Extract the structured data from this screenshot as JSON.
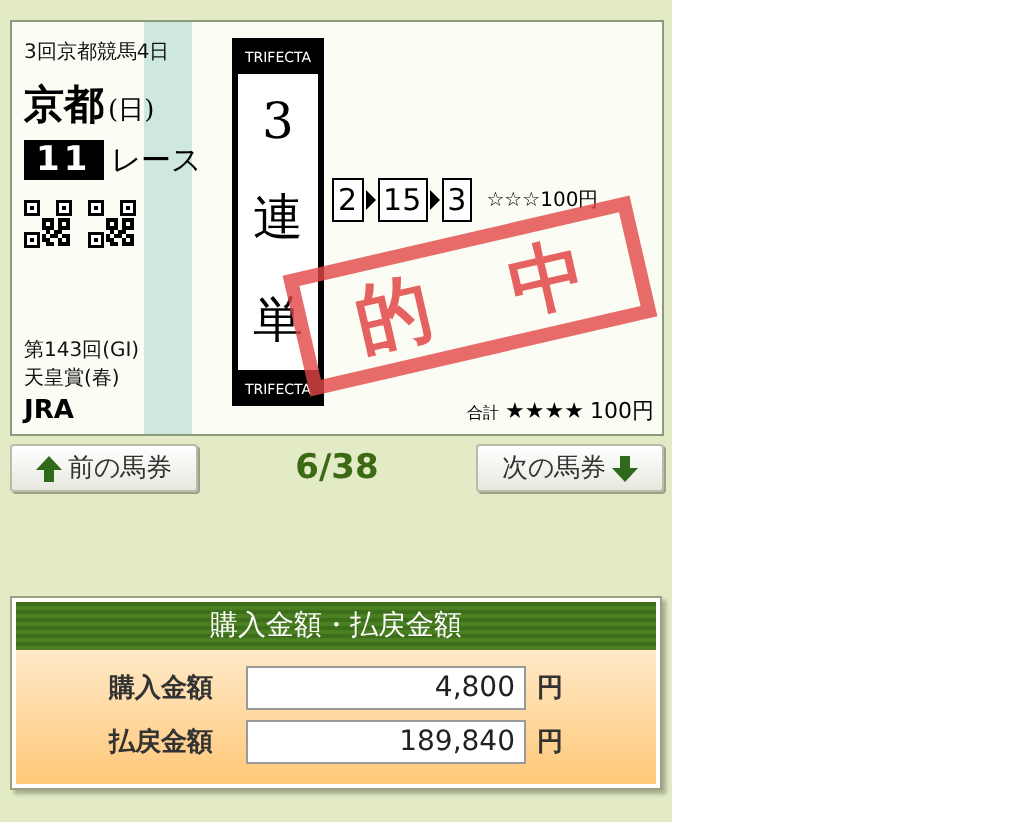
{
  "ticket": {
    "meeting": "3回京都競馬4日",
    "venue": "京都",
    "day": "(日)",
    "race_number": "11",
    "race_label": "レース",
    "race_info": [
      "第143回(GI)",
      "天皇賞(春)"
    ],
    "issuer": "JRA",
    "bet_type": {
      "label_top": "TRIFECTA",
      "chars": [
        "3",
        "連",
        "単"
      ],
      "label_bottom": "TRIFECTA"
    },
    "combination": [
      "2",
      "15",
      "3"
    ],
    "stars_text": "☆☆☆",
    "amount": "100円",
    "total_label": "合計",
    "total_stars": "★★★★",
    "total_amount": "100円",
    "stamp": "的 中"
  },
  "nav": {
    "prev": "前の馬券",
    "counter": "6/38",
    "next": "次の馬券"
  },
  "summary": {
    "title": "購入金額・払戻金額",
    "rows": [
      {
        "label": "購入金額",
        "value": "4,800",
        "unit": "円"
      },
      {
        "label": "払戻金額",
        "value": "189,840",
        "unit": "円"
      }
    ]
  }
}
